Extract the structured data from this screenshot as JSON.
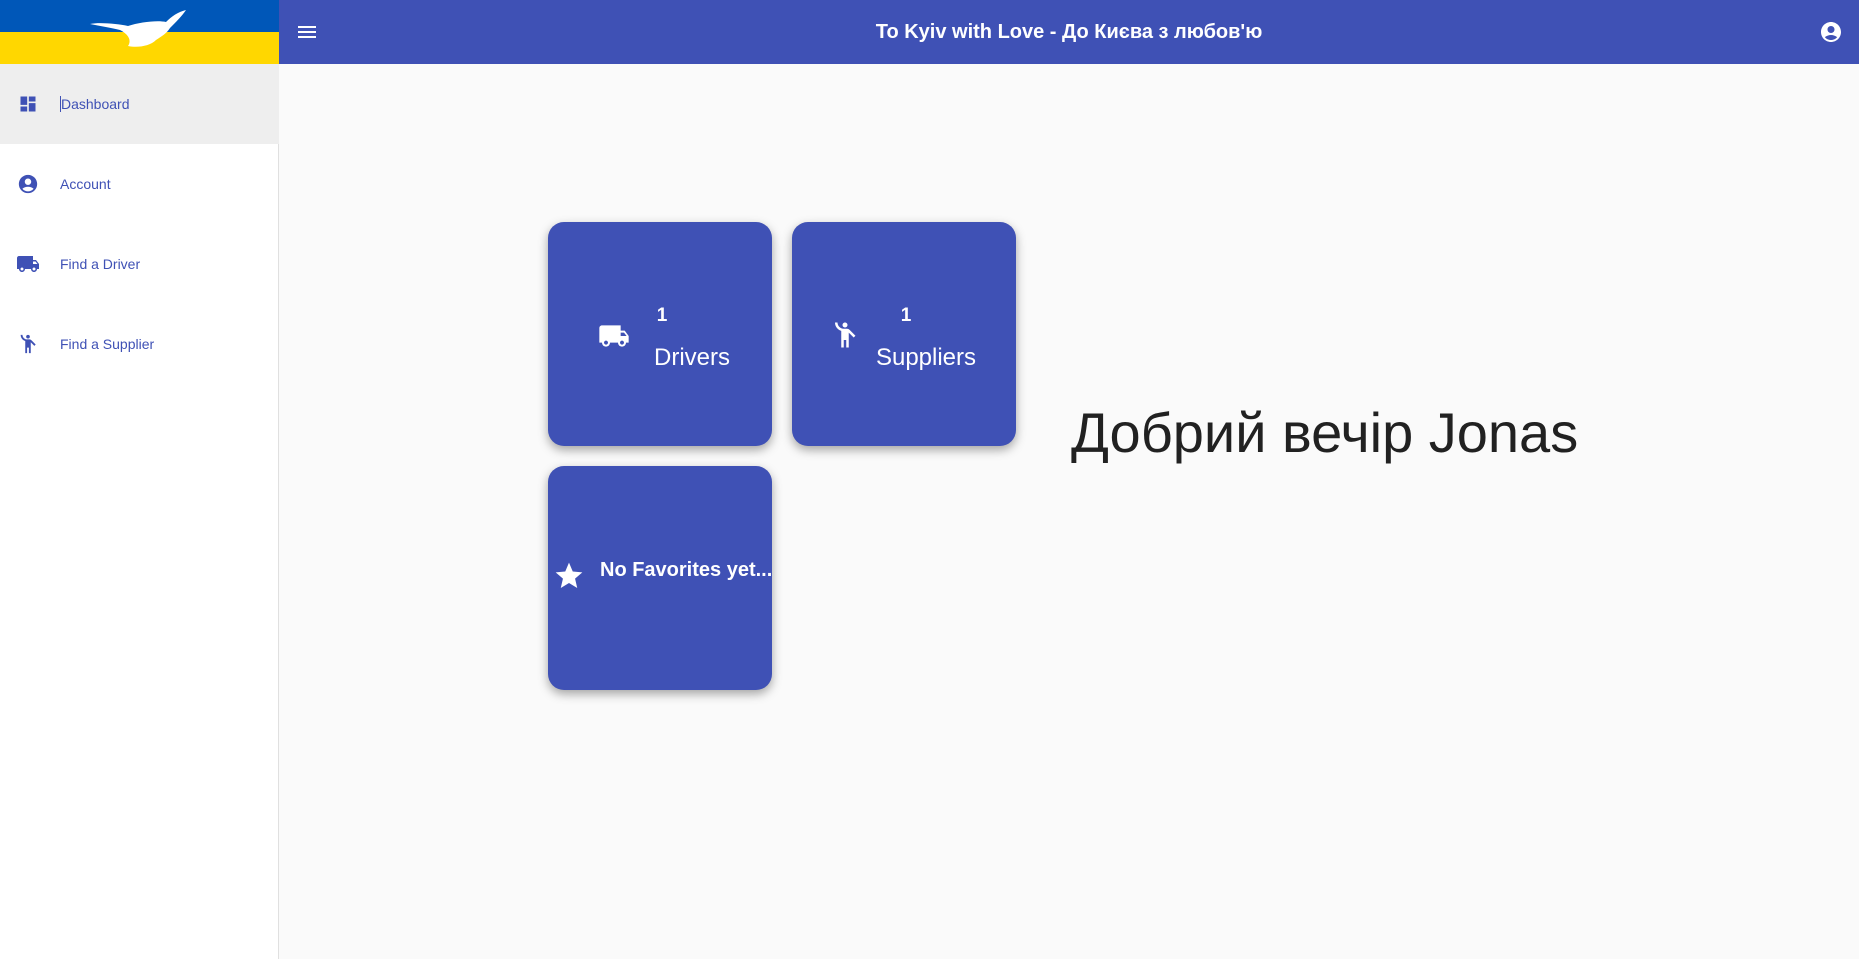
{
  "app": {
    "title": "To Kyiv with Love - До Києва з любов'ю",
    "accent_color": "#3f51b5",
    "flag_colors": {
      "blue": "#0057b8",
      "yellow": "#ffd700"
    }
  },
  "sidebar": {
    "items": [
      {
        "label": "Dashboard",
        "icon": "dashboard-icon",
        "active": true
      },
      {
        "label": "Account",
        "icon": "account-circle-icon",
        "active": false
      },
      {
        "label": "Find a Driver",
        "icon": "truck-icon",
        "active": false
      },
      {
        "label": "Find a Supplier",
        "icon": "person-hailing-icon",
        "active": false
      }
    ]
  },
  "tiles": {
    "drivers": {
      "count": "1",
      "label": "Drivers",
      "icon": "truck-icon"
    },
    "suppliers": {
      "count": "1",
      "label": "Suppliers",
      "icon": "person-hailing-icon"
    },
    "favorites": {
      "text": "No Favorites yet...",
      "icon": "star-icon"
    }
  },
  "greeting": "Добрий вечір Jonas"
}
